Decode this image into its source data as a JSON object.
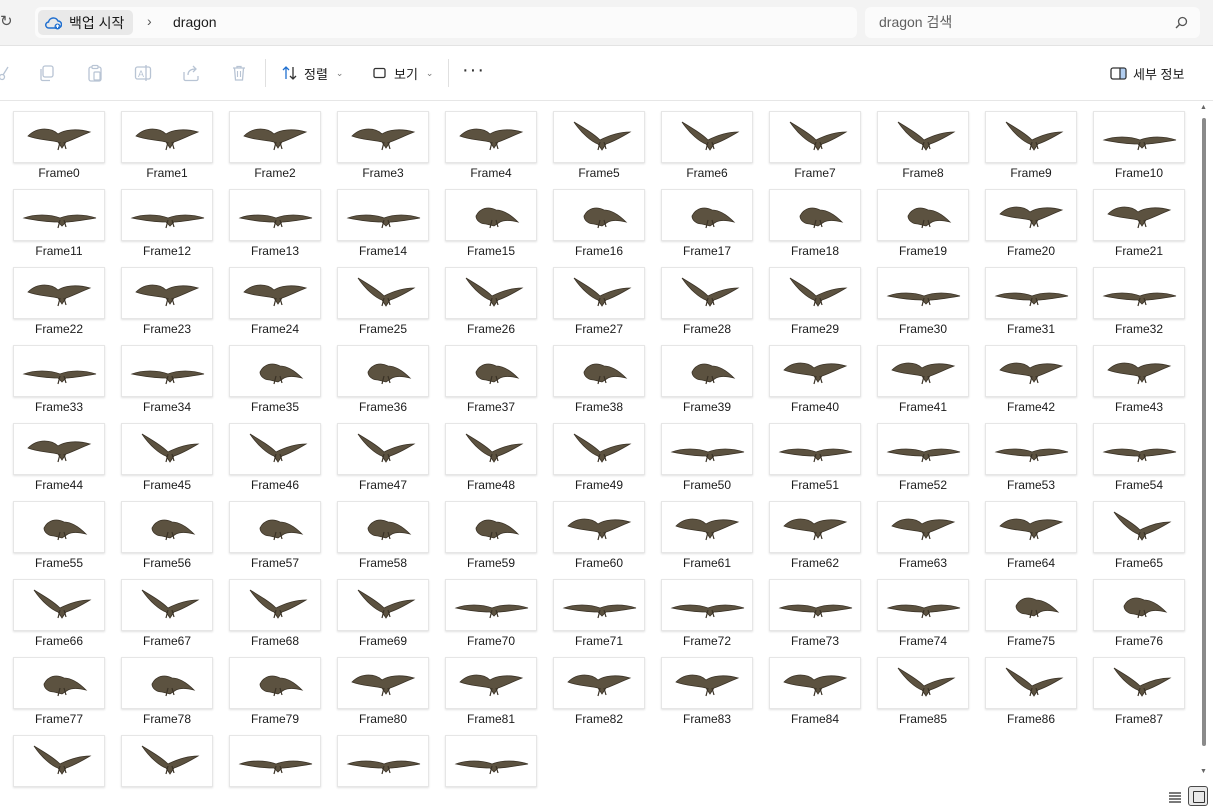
{
  "address": {
    "home_label": "백업 시작",
    "separator": "›",
    "current_folder": "dragon",
    "home_icon": "cloud-backup-icon"
  },
  "search": {
    "placeholder": "dragon 검색",
    "value": ""
  },
  "toolbar": {
    "cut_icon": "scissors-icon",
    "copy_icon": "copy-icon",
    "paste_icon": "paste-icon",
    "rename_icon": "rename-icon",
    "share_icon": "share-icon",
    "delete_icon": "trash-icon",
    "sort_label": "정렬",
    "view_label": "보기",
    "more_label": "···",
    "details_label": "세부 정보"
  },
  "files": [
    "Frame0",
    "Frame1",
    "Frame2",
    "Frame3",
    "Frame4",
    "Frame5",
    "Frame6",
    "Frame7",
    "Frame8",
    "Frame9",
    "Frame10",
    "Frame11",
    "Frame12",
    "Frame13",
    "Frame14",
    "Frame15",
    "Frame16",
    "Frame17",
    "Frame18",
    "Frame19",
    "Frame20",
    "Frame21",
    "Frame22",
    "Frame23",
    "Frame24",
    "Frame25",
    "Frame26",
    "Frame27",
    "Frame28",
    "Frame29",
    "Frame30",
    "Frame31",
    "Frame32",
    "Frame33",
    "Frame34",
    "Frame35",
    "Frame36",
    "Frame37",
    "Frame38",
    "Frame39",
    "Frame40",
    "Frame41",
    "Frame42",
    "Frame43",
    "Frame44",
    "Frame45",
    "Frame46",
    "Frame47",
    "Frame48",
    "Frame49",
    "Frame50",
    "Frame51",
    "Frame52",
    "Frame53",
    "Frame54",
    "Frame55",
    "Frame56",
    "Frame57",
    "Frame58",
    "Frame59",
    "Frame60",
    "Frame61",
    "Frame62",
    "Frame63",
    "Frame64",
    "Frame65",
    "Frame66",
    "Frame67",
    "Frame68",
    "Frame69",
    "Frame70",
    "Frame71",
    "Frame72",
    "Frame73",
    "Frame74",
    "Frame75",
    "Frame76",
    "Frame77",
    "Frame78",
    "Frame79",
    "Frame80",
    "Frame81",
    "Frame82",
    "Frame83",
    "Frame84",
    "Frame85",
    "Frame86",
    "Frame87",
    "",
    "",
    "",
    "",
    ""
  ],
  "view_buttons": {
    "details_icon": "details-view-icon",
    "tiles_icon": "large-icons-view-icon"
  }
}
